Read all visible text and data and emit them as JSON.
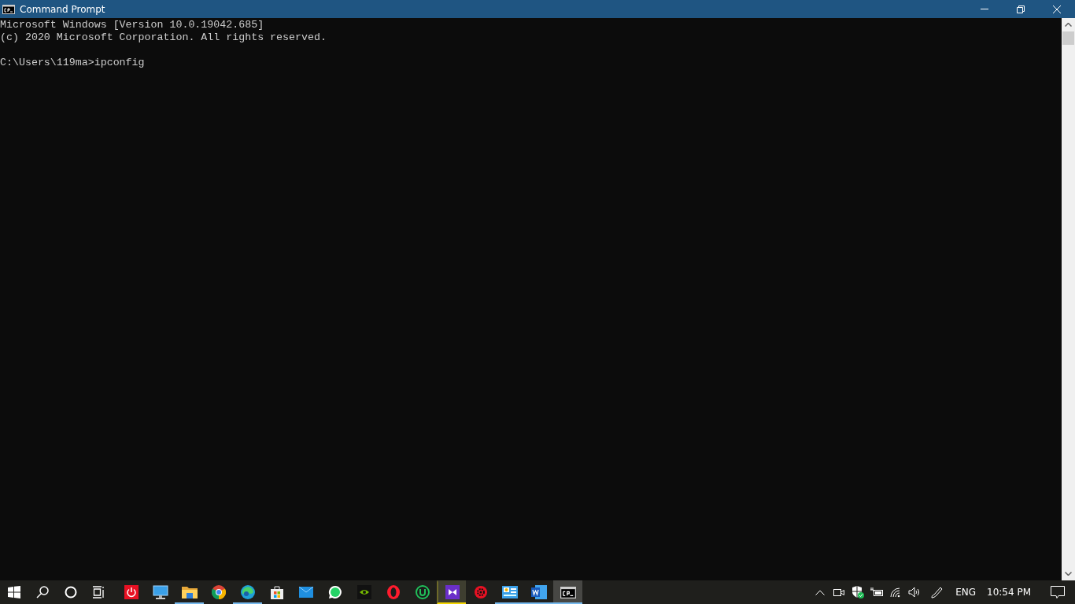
{
  "window": {
    "title": "Command Prompt"
  },
  "console": {
    "blocks": [
      [
        "Microsoft Windows [Version 10.0.19042.685]",
        "(c) 2020 Microsoft Corporation. All rights reserved."
      ],
      [
        "C:\\Users\\119ma>ipconfig"
      ]
    ]
  },
  "taskbar": {
    "apps": [
      {
        "kind": "power",
        "running": false,
        "selected": false,
        "flashing": false
      },
      {
        "kind": "monitor",
        "running": false,
        "selected": false,
        "flashing": false
      },
      {
        "kind": "folder",
        "running": true,
        "selected": false,
        "flashing": false
      },
      {
        "kind": "chrome",
        "running": false,
        "selected": false,
        "flashing": false
      },
      {
        "kind": "edge",
        "running": true,
        "selected": false,
        "flashing": false
      },
      {
        "kind": "store",
        "running": false,
        "selected": false,
        "flashing": false
      },
      {
        "kind": "mail",
        "running": false,
        "selected": false,
        "flashing": false
      },
      {
        "kind": "whatsapp",
        "running": false,
        "selected": false,
        "flashing": false
      },
      {
        "kind": "nvidia",
        "running": false,
        "selected": false,
        "flashing": false
      },
      {
        "kind": "opera",
        "running": false,
        "selected": false,
        "flashing": false
      },
      {
        "kind": "utorrent",
        "running": false,
        "selected": false,
        "flashing": false
      },
      {
        "kind": "vs",
        "running": true,
        "selected": false,
        "flashing": true
      },
      {
        "kind": "gear",
        "running": false,
        "selected": false,
        "flashing": false
      },
      {
        "kind": "control",
        "running": true,
        "selected": false,
        "flashing": false
      },
      {
        "kind": "word",
        "running": true,
        "selected": false,
        "flashing": false
      },
      {
        "kind": "cmd",
        "running": true,
        "selected": true,
        "flashing": false
      }
    ],
    "language": "ENG",
    "time": "10:54 PM"
  }
}
